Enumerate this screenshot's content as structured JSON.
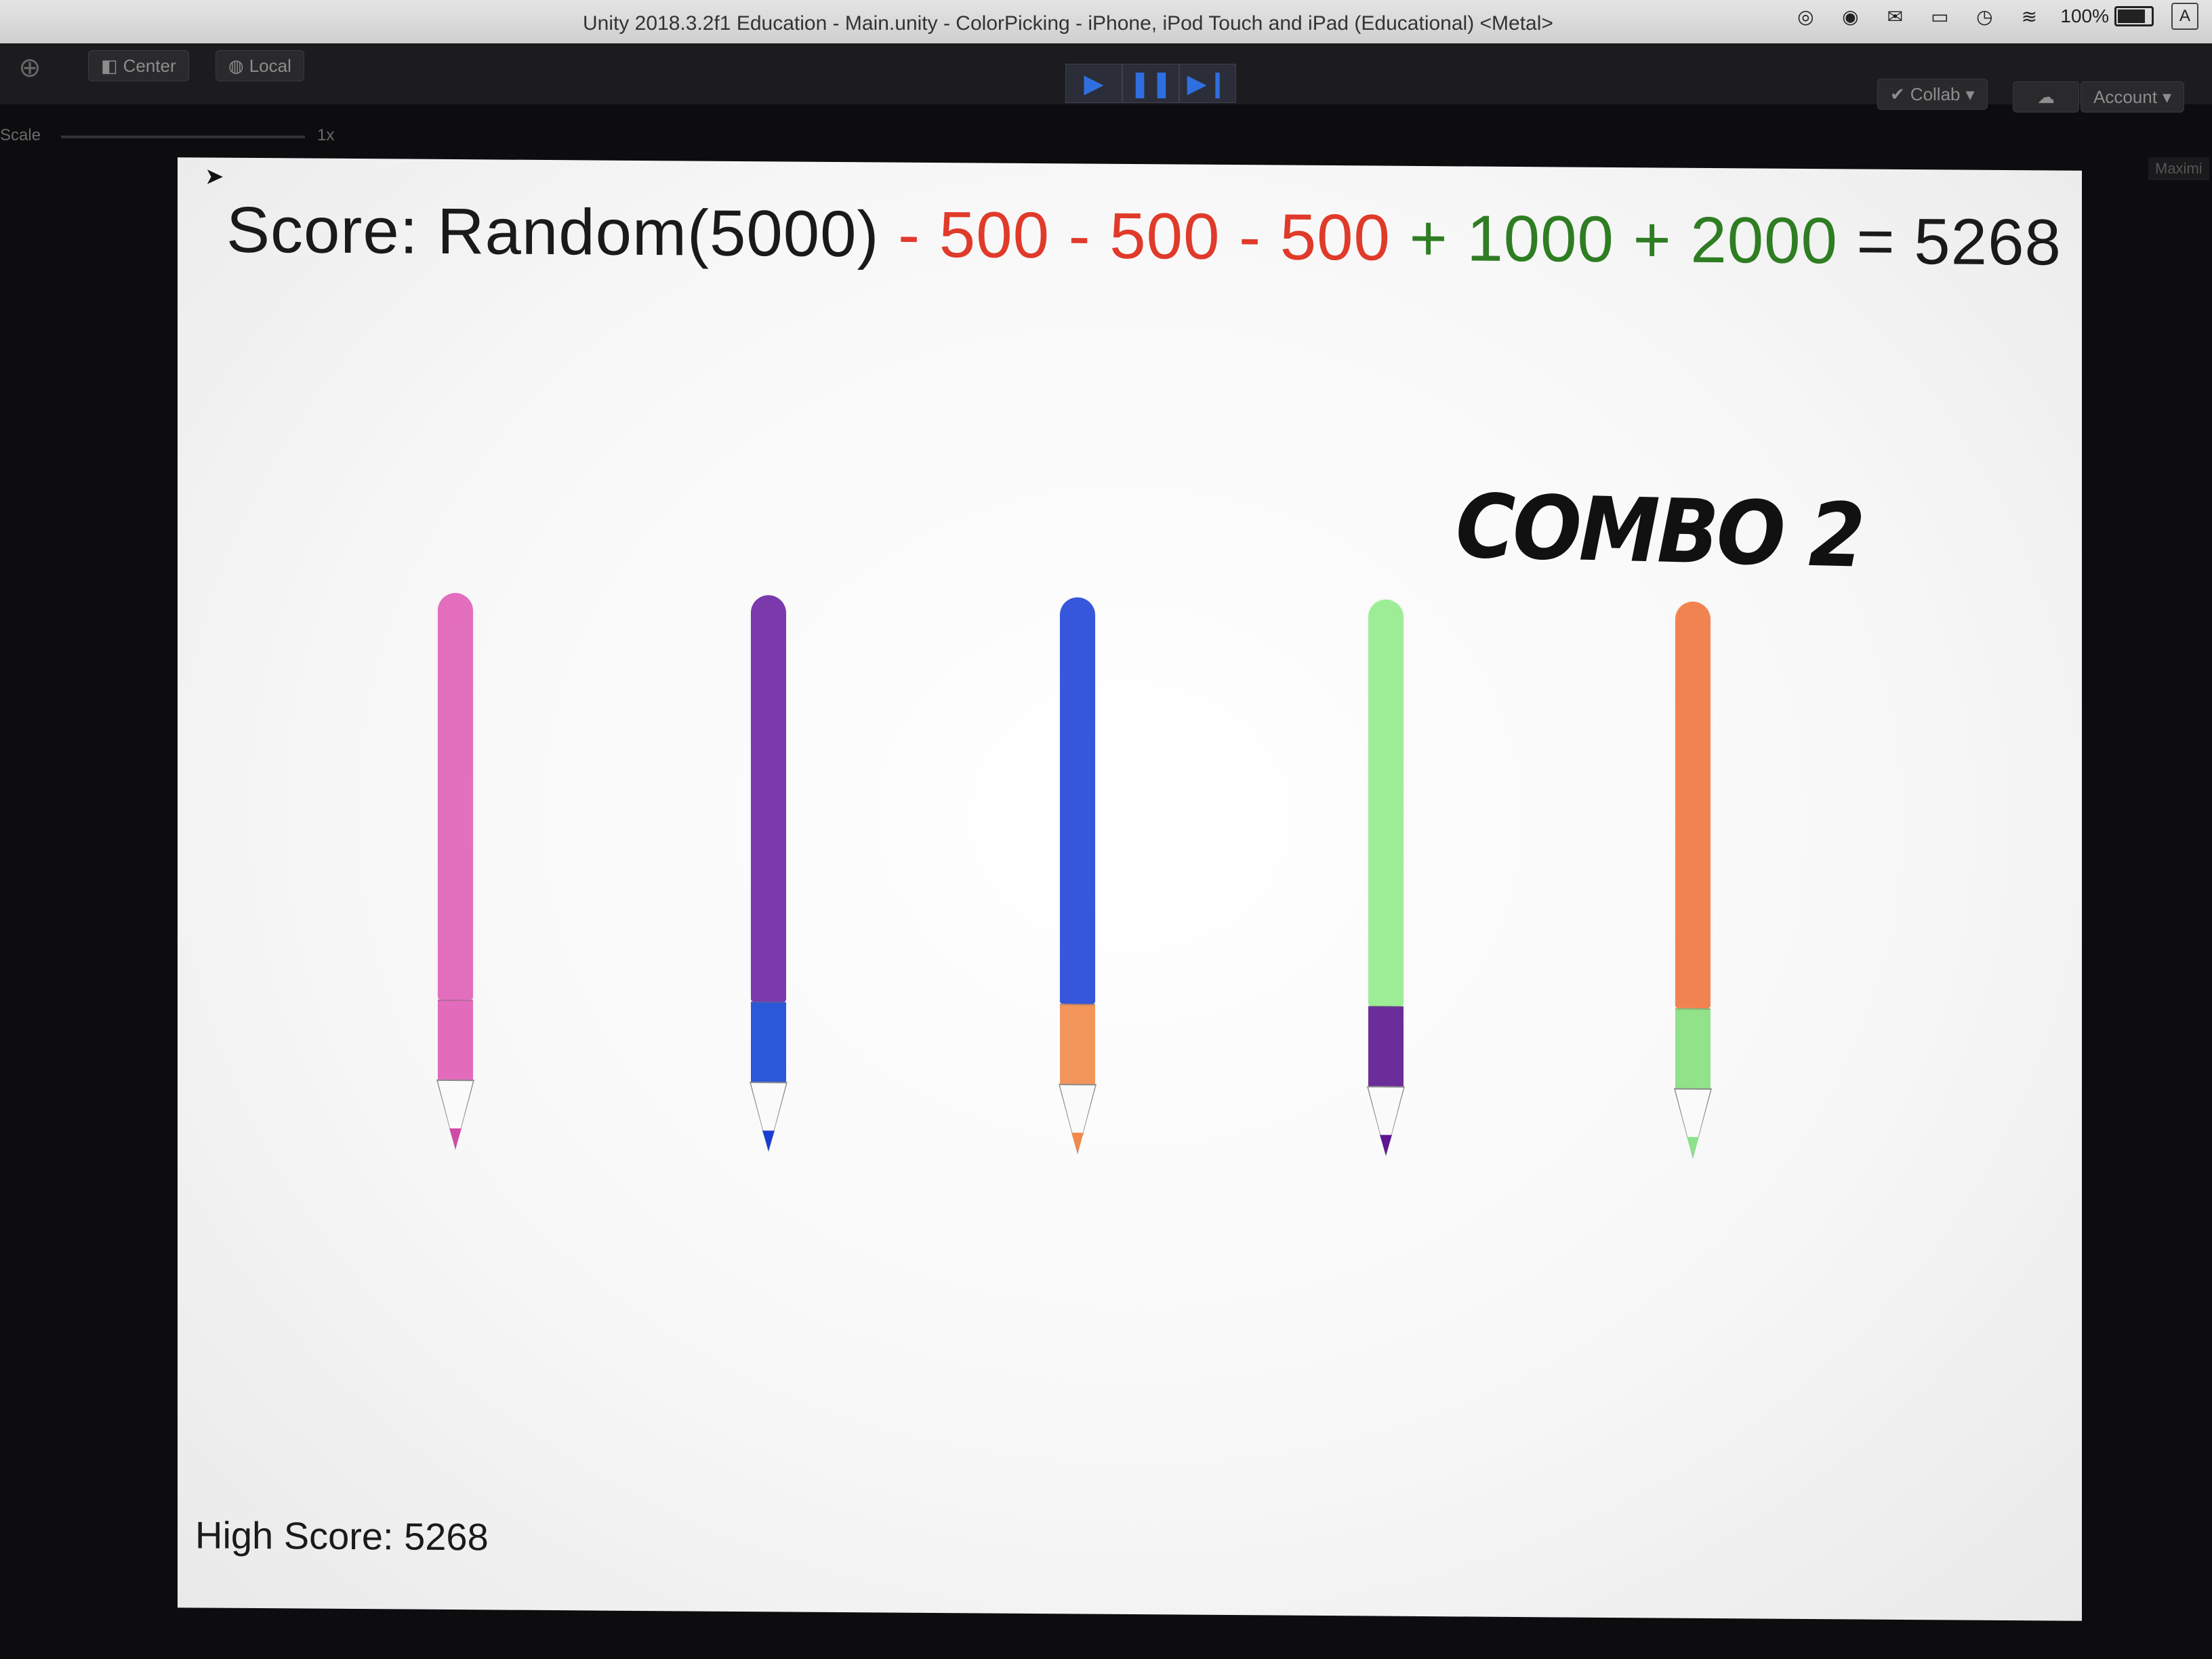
{
  "window": {
    "title": "Unity 2018.3.2f1 Education - Main.unity - ColorPicking - iPhone, iPod Touch and iPad (Educational) <Metal>",
    "battery": "100%",
    "user_badge": "A"
  },
  "toolbar": {
    "center_label": "Center",
    "local_label": "Local",
    "collab_label": "Collab",
    "account_label": "Account"
  },
  "game_view": {
    "scale_label": "Scale",
    "scale_value": "1x",
    "maximize_label": "Maximi"
  },
  "game": {
    "score_prefix": "Score: Random(5000)",
    "score_terms": [
      {
        "text": " - 500",
        "kind": "neg"
      },
      {
        "text": " - 500",
        "kind": "neg"
      },
      {
        "text": " - 500",
        "kind": "neg"
      },
      {
        "text": " + 1000",
        "kind": "pos"
      },
      {
        "text": " + 2000",
        "kind": "pos"
      }
    ],
    "score_total": " = 5268",
    "combo": "COMBO 2",
    "high_score": "High Score: 5268",
    "pencils": [
      {
        "body_color": "#e05cb6",
        "band_color": "#e05cb6",
        "lead_color": "#d04aa8"
      },
      {
        "body_color": "#6a1fa0",
        "band_color": "#1447d6",
        "lead_color": "#1a3fd0"
      },
      {
        "body_color": "#1b3fd8",
        "band_color": "#f28a4a",
        "lead_color": "#f08a4a"
      },
      {
        "body_color": "#90ec88",
        "band_color": "#5c1790",
        "lead_color": "#5c1790"
      },
      {
        "body_color": "#f0733a",
        "band_color": "#86e07c",
        "lead_color": "#8be28a"
      }
    ]
  },
  "colors": {
    "negative": "#e03a2a",
    "positive": "#2f7d23",
    "play_accent": "#2f6fe0"
  }
}
